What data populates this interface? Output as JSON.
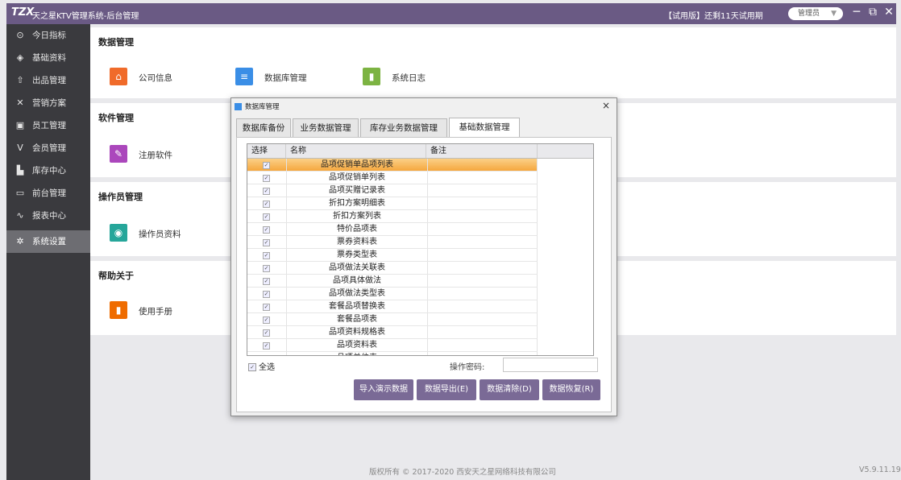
{
  "titlebar": {
    "logo": "TZX",
    "title": "天之星KTV管理系统-后台管理",
    "trial": "【试用版】还剩11天试用期",
    "user": "管理员",
    "user_arrow": "▼",
    "minimize": "─",
    "restore": "⧉",
    "close": "✕"
  },
  "sidebar": {
    "items": [
      {
        "label": "今日指标",
        "icon": "⊙"
      },
      {
        "label": "基础资料",
        "icon": "◈"
      },
      {
        "label": "出品管理",
        "icon": "⇧"
      },
      {
        "label": "营销方案",
        "icon": "✕"
      },
      {
        "label": "员工管理",
        "icon": "▣"
      },
      {
        "label": "会员管理",
        "icon": "V"
      },
      {
        "label": "库存中心",
        "icon": "▙"
      },
      {
        "label": "前台管理",
        "icon": "▭"
      },
      {
        "label": "报表中心",
        "icon": "∿"
      },
      {
        "label": "系统设置",
        "icon": "✲"
      }
    ]
  },
  "sections": {
    "data": {
      "heading": "数据管理",
      "tiles": [
        {
          "label": "公司信息",
          "icon": "⌂",
          "color": "#f06b2a"
        },
        {
          "label": "数据库管理",
          "icon": "≡",
          "color": "#3a8ee6"
        },
        {
          "label": "系统日志",
          "icon": "▮",
          "color": "#7cb342"
        }
      ]
    },
    "software": {
      "heading": "软件管理",
      "tiles": [
        {
          "label": "注册软件",
          "icon": "✎",
          "color": "#ab47bc"
        }
      ]
    },
    "operator": {
      "heading": "操作员管理",
      "tiles": [
        {
          "label": "操作员资料",
          "icon": "◉",
          "color": "#26a69a"
        }
      ]
    },
    "help": {
      "heading": "帮助关于",
      "tiles": [
        {
          "label": "使用手册",
          "icon": "▮",
          "color": "#ef6c00"
        }
      ]
    }
  },
  "footer": {
    "copyright": "版权所有 © 2017-2020 西安天之星网络科技有限公司",
    "version": "V5.9.11.19"
  },
  "dialog": {
    "title": "数据库管理",
    "close": "×",
    "tabs": [
      "数据库备份",
      "业务数据管理",
      "库存业务数据管理",
      "基础数据管理"
    ],
    "active_tab": 3,
    "columns": [
      "选择",
      "名称",
      "备注"
    ],
    "rows": [
      "品项促销单品项列表",
      "品项促销单列表",
      "品项买赠记录表",
      "折扣方案明细表",
      "折扣方案列表",
      "特价品项表",
      "票券资料表",
      "票券类型表",
      "品项做法关联表",
      "品项具体做法",
      "品项做法类型表",
      "套餐品项替换表",
      "套餐品项表",
      "品项资料规格表",
      "品项资料表",
      "品项单位表"
    ],
    "check_mark": "✓",
    "select_all": "全选",
    "password_label": "操作密码:",
    "password_value": "",
    "buttons": [
      "导入演示数据",
      "数据导出(E)",
      "数据清除(D)",
      "数据恢复(R)"
    ],
    "scroll_up": "▲",
    "scroll_down": "▼"
  },
  "colors": {
    "titlebar": "#6a5a84",
    "sidebar": "#3a3a3e",
    "button": "#7a6a96",
    "selected_row": "#f5a73e"
  }
}
